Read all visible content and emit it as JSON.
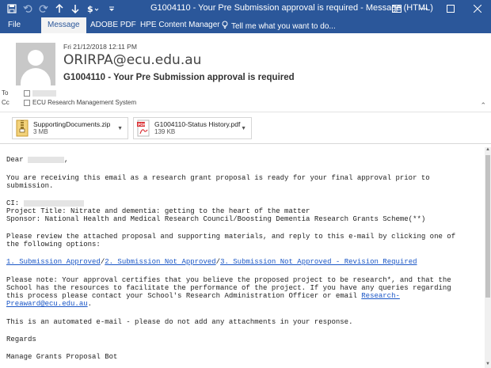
{
  "window": {
    "title": "G1004110 - Your Pre Submission approval is required - Message (HTML)",
    "colors": {
      "titlebar": "#2b579a",
      "link": "#1a56c6"
    }
  },
  "ribbon": {
    "tabs": [
      {
        "label": "File",
        "active": false
      },
      {
        "label": "Message",
        "active": true
      },
      {
        "label": "ADOBE PDF",
        "active": false
      },
      {
        "label": "HPE Content Manager",
        "active": false
      },
      {
        "label": "Tell me what you want to do...",
        "active": false,
        "icon": "lightbulb-icon"
      }
    ]
  },
  "header": {
    "date": "Fri 21/12/2018 12:11 PM",
    "sender": "ORIRPA@ecu.edu.au",
    "subject": "G1004110 - Your Pre Submission approval is required",
    "to_label": "To",
    "cc_label": "Cc",
    "cc_name": "ECU Research Management System"
  },
  "attachments": [
    {
      "name": "SupportingDocuments.zip",
      "size": "3 MB",
      "icon": "zip-icon"
    },
    {
      "name": "G1004110-Status History.pdf",
      "size": "139 KB",
      "icon": "pdf-icon"
    }
  ],
  "body": {
    "greeting": "Dear",
    "greeting_tail": ",",
    "intro1": "You are receiving this email as a research grant proposal is ready for your final approval prior to",
    "intro2": "submission.",
    "ci_label": "CI:",
    "project": "Project Title: Nitrate and dementia: getting to the heart of the matter",
    "sponsor": "Sponsor: National Health and Medical Research Council/Boosting Dementia Research Grants Scheme(**)",
    "review1": "Please review the attached proposal and supporting materials, and reply to this e-mail by clicking one of",
    "review2": "the following options:",
    "opt1": "1. Submission Approved",
    "opt2": "2. Submission Not Approved",
    "opt3": "3. Submission Not Approved - Revision Required",
    "slash": "/",
    "note1": "Please note: Your approval certifies that you believe the proposed project to be research*, and that the",
    "note2": "School has the resources to facilitate the performance of the project. If you have any queries regarding",
    "note3a": "this process please contact your School's Research Administration Officer or email ",
    "note3link": "Research-",
    "note4link": "Preaward@ecu.edu.au",
    "note4tail": ".",
    "automated": "This is an automated e-mail - please do not add any attachments in your response.",
    "regards": "Regards",
    "signature": "Manage Grants Proposal Bot"
  }
}
